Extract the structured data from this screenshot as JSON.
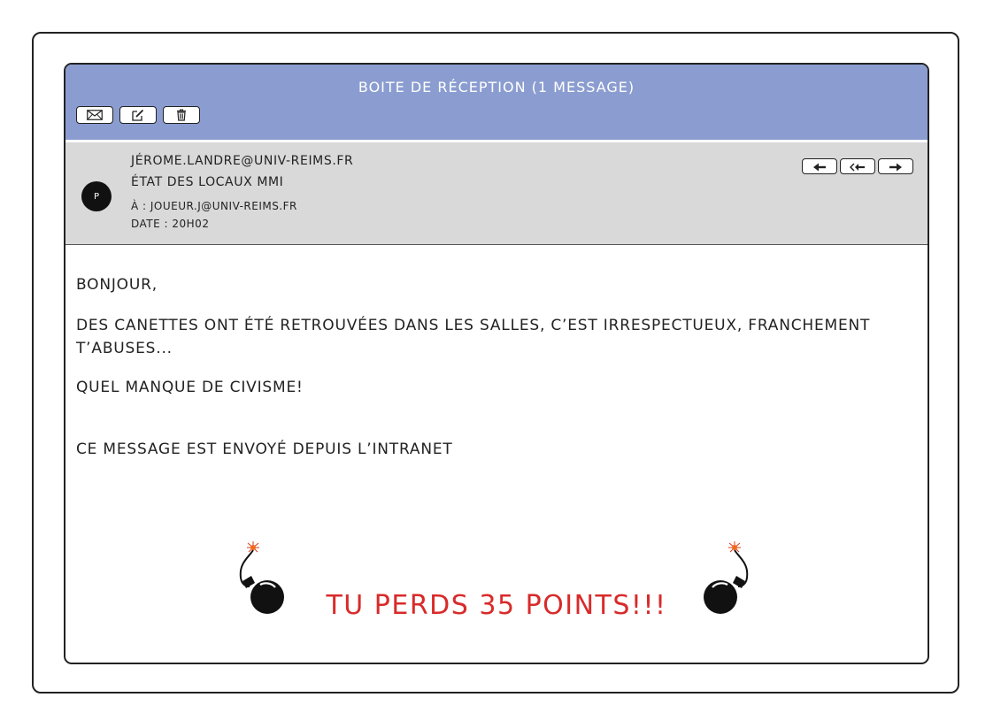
{
  "window": {
    "title": "Boite de réception (1 message)"
  },
  "toolbar": {
    "buttons": [
      {
        "icon": "envelope-icon"
      },
      {
        "icon": "compose-icon"
      },
      {
        "icon": "trash-icon"
      }
    ]
  },
  "message": {
    "avatar_initial": "P",
    "sender": "jérome.landre@univ-reims.fr",
    "subject": "État des locaux MMI",
    "to": "À : joueur.j@univ-reims.fr",
    "date": "Date : 20h02",
    "actions": [
      {
        "icon": "reply-icon"
      },
      {
        "icon": "reply-all-icon"
      },
      {
        "icon": "forward-icon"
      }
    ],
    "body": {
      "greeting": "Bonjour,",
      "paragraph": "Des canettes ont été retrouvées dans les salles, c’est irrespectueux, franchement t’abuses...",
      "exclamation": "Quel manque de civisme!",
      "signature": "Ce message est envoyé depuis l’intranet"
    }
  },
  "penalty": {
    "text": "Tu perds 35 points!!!",
    "color": "#d92a2a"
  },
  "colors": {
    "title_bar": "#8b9dd0",
    "header_pane": "#d9d9d9"
  }
}
